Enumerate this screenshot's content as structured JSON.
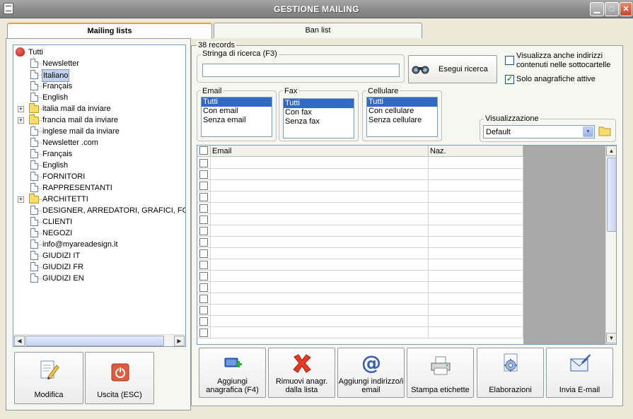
{
  "window": {
    "title": "GESTIONE MAILING"
  },
  "tabs": {
    "left": "Mailing lists",
    "right": "Ban list"
  },
  "tree": {
    "root": "Tutti",
    "items": [
      {
        "label": "Newsletter",
        "type": "page",
        "selected": false
      },
      {
        "label": "Italiano",
        "type": "page",
        "selected": true
      },
      {
        "label": "Français",
        "type": "page",
        "selected": false
      },
      {
        "label": "English",
        "type": "page",
        "selected": false
      },
      {
        "label": "italia mail da inviare",
        "type": "folder",
        "selected": false
      },
      {
        "label": "francia mail da inviare",
        "type": "folder",
        "selected": false
      },
      {
        "label": "inglese mail da inviare",
        "type": "page",
        "selected": false
      },
      {
        "label": "Newsletter .com",
        "type": "page",
        "selected": false
      },
      {
        "label": "Français",
        "type": "page",
        "selected": false
      },
      {
        "label": "English",
        "type": "page",
        "selected": false
      },
      {
        "label": "FORNITORI",
        "type": "page",
        "selected": false
      },
      {
        "label": "RAPPRESENTANTI",
        "type": "page",
        "selected": false
      },
      {
        "label": "ARCHITETTI",
        "type": "folder",
        "selected": false
      },
      {
        "label": "DESIGNER, ARREDATORI, GRAFICI, FOTO",
        "type": "page",
        "selected": false
      },
      {
        "label": "CLIENTI",
        "type": "page",
        "selected": false
      },
      {
        "label": "NEGOZI",
        "type": "page",
        "selected": false
      },
      {
        "label": "info@myareadesign.it",
        "type": "page",
        "selected": false
      },
      {
        "label": "GIUDIZI IT",
        "type": "page",
        "selected": false
      },
      {
        "label": "GIUDIZI FR",
        "type": "page",
        "selected": false
      },
      {
        "label": "GIUDIZI EN",
        "type": "page",
        "selected": false
      }
    ]
  },
  "left_buttons": {
    "modifica": "Modifica",
    "uscita": "Uscita (ESC)"
  },
  "records": "38 records",
  "search": {
    "label": "Stringa di ricerca (F3)",
    "value": "",
    "button": "Esegui ricerca"
  },
  "options": {
    "subfolders": "Visualizza anche indirizzi contenuti nelle sottocartelle",
    "subfolders_checked": false,
    "active_only": "Solo anagrafiche attive",
    "active_only_checked": true
  },
  "filters": {
    "email": {
      "label": "Email",
      "options": [
        "Tutti",
        "Con email",
        "Senza email"
      ],
      "selected": 0
    },
    "fax": {
      "label": "Fax",
      "options": [
        "Tutti",
        "Con fax",
        "Senza fax"
      ],
      "selected": 0
    },
    "cellulare": {
      "label": "Cellulare",
      "options": [
        "Tutti",
        "Con cellulare",
        "Senza cellulare"
      ],
      "selected": 0
    }
  },
  "visualizzazione": {
    "label": "Visualizzazione",
    "value": "Default"
  },
  "grid": {
    "columns": [
      "Email",
      "Naz."
    ],
    "row_count": 16
  },
  "actions": [
    {
      "name": "aggiungi-anagrafica-button",
      "icon": "add-contact-icon",
      "label": "Aggiungi anagrafica (F4)"
    },
    {
      "name": "rimuovi-anagrafica-button",
      "icon": "red-x-icon",
      "label": "Rimuovi anagr. dalla lista"
    },
    {
      "name": "aggiungi-email-button",
      "icon": "at-sign-icon",
      "label": "Aggiungi indirizzo/i email"
    },
    {
      "name": "stampa-etichette-button",
      "icon": "printer-icon",
      "label": "Stampa etichette"
    },
    {
      "name": "elaborazioni-button",
      "icon": "gear-document-icon",
      "label": "Elaborazioni"
    },
    {
      "name": "invia-email-button",
      "icon": "envelope-icon",
      "label": "Invia E-mail"
    }
  ],
  "colors": {
    "accent": "#316ac5",
    "title_bar": "#8c8c8c",
    "close_button": "#c8462a",
    "window_bg": "#ece9d8"
  }
}
